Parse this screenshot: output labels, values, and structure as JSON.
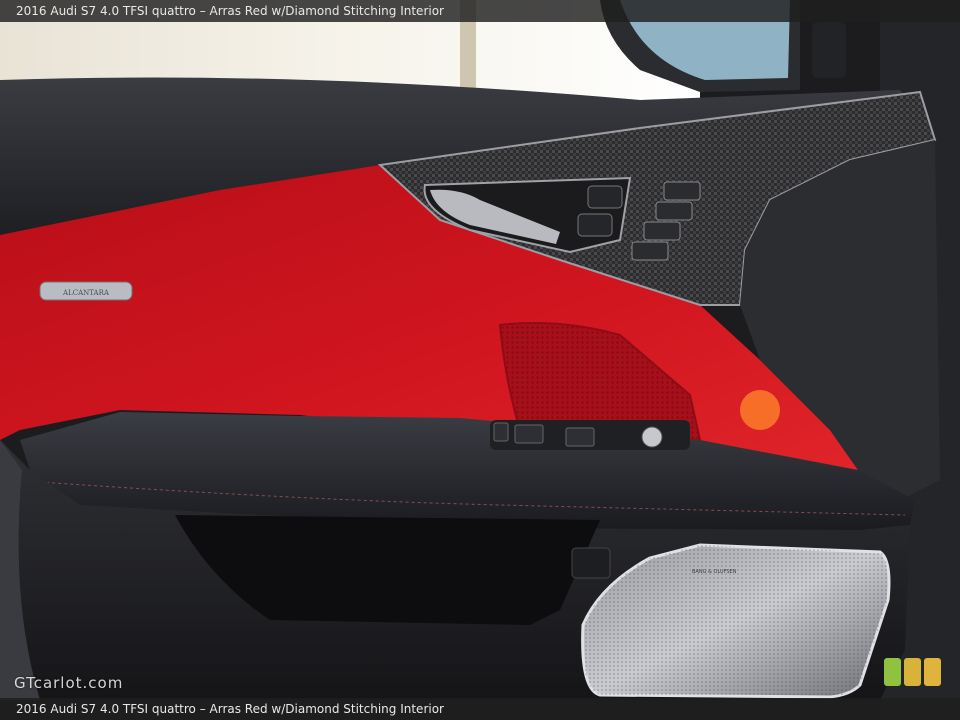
{
  "header": {
    "caption": "2016 Audi S7 4.0 TFSI quattro – Arras Red w/Diamond Stitching Interior"
  },
  "footer": {
    "caption": "2016 Audi S7 4.0 TFSI quattro – Arras Red w/Diamond Stitching Interior"
  },
  "watermark": {
    "text": "GTcarlot.com"
  },
  "photo": {
    "trim_badge_text": "ALCANTARA",
    "speaker_brand_text": "BANG & OLUFSEN",
    "colors": {
      "red_panel": "#c8131c",
      "dark_trim": "#2a2b2f",
      "carbon": "#3a3a3c",
      "window_light": "#f2efe6"
    }
  },
  "badges": {
    "colors": [
      "#8fc23f",
      "#d9b23a",
      "#e0b43c"
    ]
  }
}
